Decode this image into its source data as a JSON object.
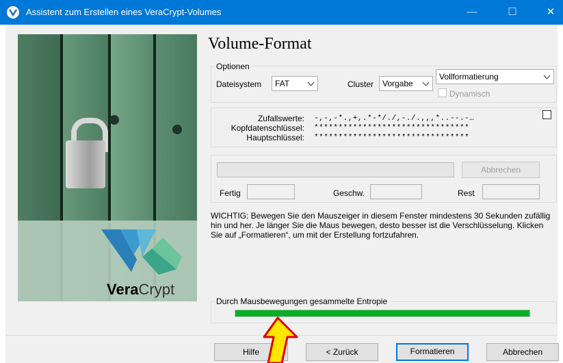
{
  "window": {
    "title": "Assistent zum Erstellen eines VeraCrypt-Volumes",
    "controls": {
      "minimize": "—",
      "maximize": "☐",
      "close": "✕"
    }
  },
  "sidebar": {
    "brand_bold": "Vera",
    "brand_regular": "Crypt",
    "image": "padlock-on-green-door"
  },
  "page": {
    "title": "Volume-Format"
  },
  "options": {
    "legend": "Optionen",
    "filesystem_label": "Dateisystem",
    "filesystem_value": "FAT",
    "cluster_label": "Cluster",
    "cluster_value": "Vorgabe",
    "format_value": "Vollformatierung",
    "dynamic_label": "Dynamisch",
    "dynamic_checked": false,
    "dynamic_enabled": false
  },
  "keys": {
    "random_label": "Zufallswerte:",
    "random_value": "-,-,-*.,+,.*-*/./,-./.,,,*..--.-…",
    "header_label": "Kopfdatenschlüssel:",
    "header_value": "********************************",
    "master_label": "Hauptschlüssel:",
    "master_value": "********************************",
    "show_checked": false
  },
  "progress": {
    "abort_label": "Abbrechen",
    "done_label": "Fertig",
    "speed_label": "Geschw.",
    "remaining_label": "Rest",
    "done_value": "",
    "speed_value": "",
    "remaining_value": ""
  },
  "info_text": "WICHTIG: Bewegen Sie den Mauszeiger in diesem Fenster mindestens 30 Sekunden zufällig hin und her. Je länger Sie die Maus bewegen, desto besser ist die Verschlüsselung. Klicken Sie auf „Formatieren“, um mit der Erstellung fortzufahren.",
  "entropy": {
    "legend": "Durch Mausbewegungen gesammelte Entropie",
    "level": 1.0,
    "color": "#06b025"
  },
  "buttons": {
    "help": "Hilfe",
    "back": "< Zurück",
    "format": "Formatieren",
    "cancel": "Abbrechen"
  },
  "colors": {
    "titlebar": "#0078d7",
    "accent": "#0078d7"
  }
}
